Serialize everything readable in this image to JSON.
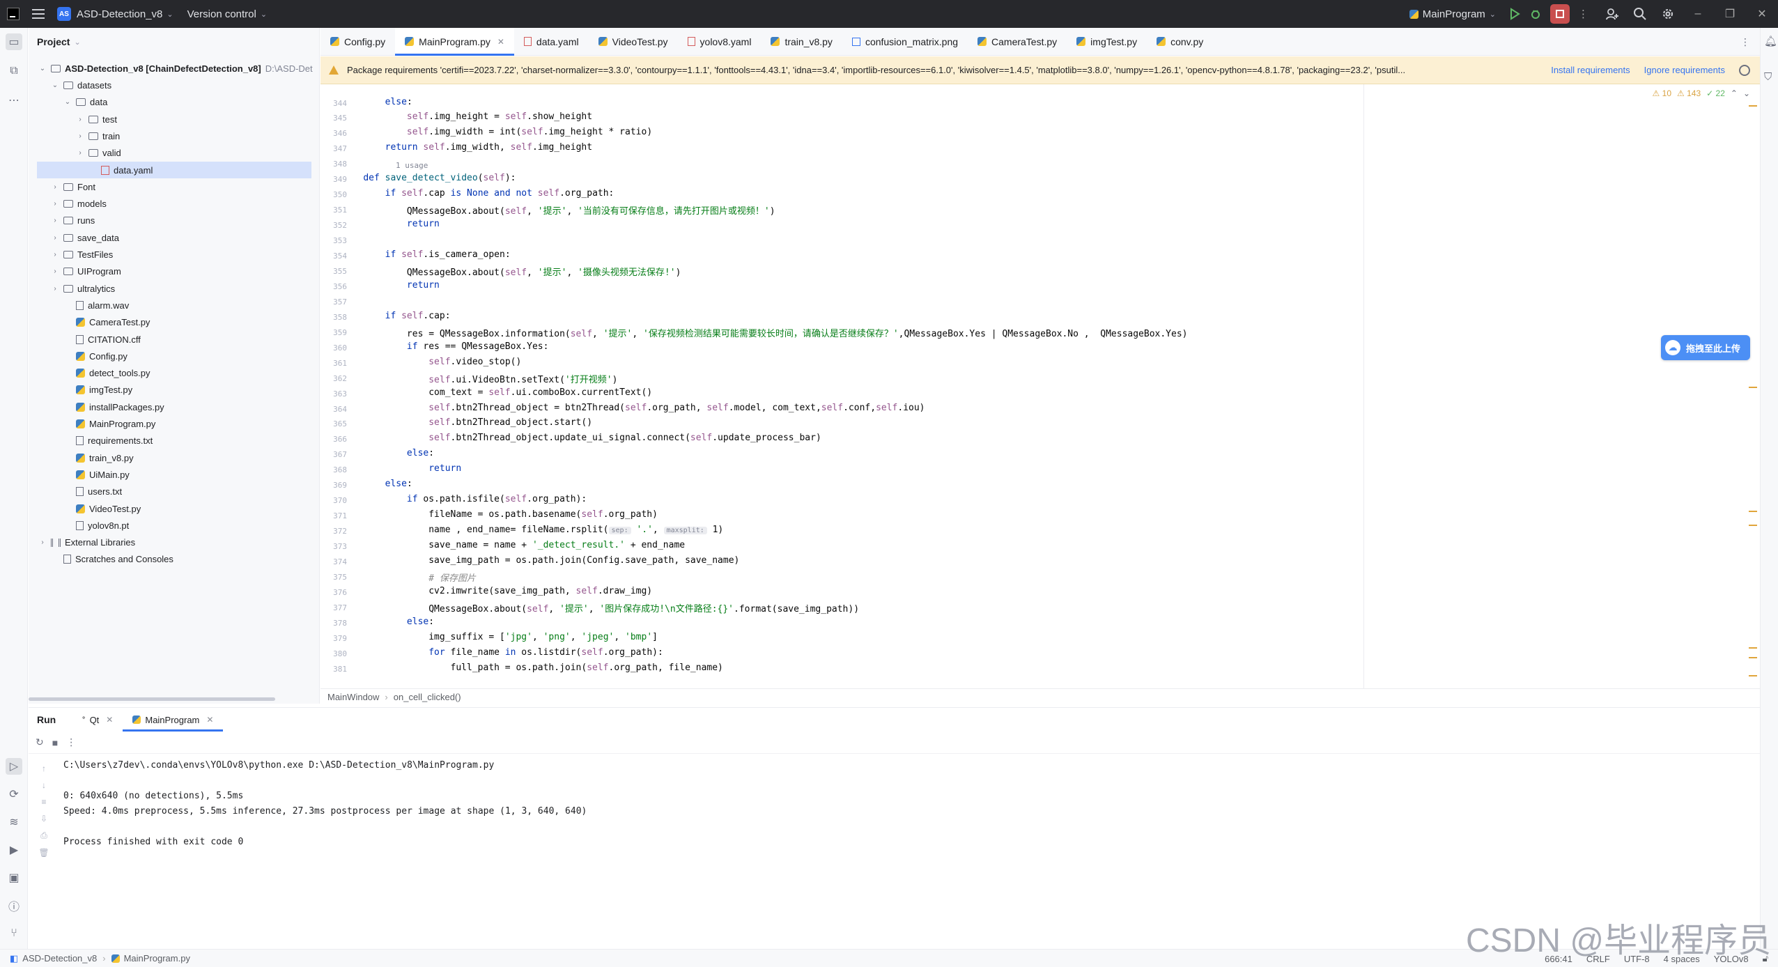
{
  "titlebar": {
    "project_name": "ASD-Detection_v8",
    "project_badge": "AS",
    "vcs": "Version control",
    "run_config": "MainProgram"
  },
  "project_panel": {
    "title": "Project",
    "root": {
      "label": "ASD-Detection_v8 [ChainDefectDetection_v8]",
      "path": "D:\\ASD-Det"
    },
    "items": [
      {
        "label": "datasets",
        "type": "folder",
        "indent": 1,
        "open": true
      },
      {
        "label": "data",
        "type": "folder",
        "indent": 2,
        "open": true
      },
      {
        "label": "test",
        "type": "folder",
        "indent": 3,
        "open": false
      },
      {
        "label": "train",
        "type": "folder",
        "indent": 3,
        "open": false
      },
      {
        "label": "valid",
        "type": "folder",
        "indent": 3,
        "open": false
      },
      {
        "label": "data.yaml",
        "type": "yaml",
        "indent": 4,
        "selected": true
      },
      {
        "label": "Font",
        "type": "folder",
        "indent": 1,
        "open": false
      },
      {
        "label": "models",
        "type": "folder",
        "indent": 1,
        "open": false
      },
      {
        "label": "runs",
        "type": "folder",
        "indent": 1,
        "open": false
      },
      {
        "label": "save_data",
        "type": "folder",
        "indent": 1,
        "open": false
      },
      {
        "label": "TestFiles",
        "type": "folder",
        "indent": 1,
        "open": false
      },
      {
        "label": "UIProgram",
        "type": "folder",
        "indent": 1,
        "open": false
      },
      {
        "label": "ultralytics",
        "type": "folder",
        "indent": 1,
        "open": false
      },
      {
        "label": "alarm.wav",
        "type": "file",
        "indent": 2
      },
      {
        "label": "CameraTest.py",
        "type": "py",
        "indent": 2
      },
      {
        "label": "CITATION.cff",
        "type": "file",
        "indent": 2
      },
      {
        "label": "Config.py",
        "type": "py",
        "indent": 2
      },
      {
        "label": "detect_tools.py",
        "type": "py",
        "indent": 2
      },
      {
        "label": "imgTest.py",
        "type": "py",
        "indent": 2
      },
      {
        "label": "installPackages.py",
        "type": "py",
        "indent": 2
      },
      {
        "label": "MainProgram.py",
        "type": "py",
        "indent": 2
      },
      {
        "label": "requirements.txt",
        "type": "file",
        "indent": 2
      },
      {
        "label": "train_v8.py",
        "type": "py",
        "indent": 2
      },
      {
        "label": "UiMain.py",
        "type": "py",
        "indent": 2
      },
      {
        "label": "users.txt",
        "type": "file",
        "indent": 2
      },
      {
        "label": "VideoTest.py",
        "type": "py",
        "indent": 2
      },
      {
        "label": "yolov8n.pt",
        "type": "file",
        "indent": 2
      },
      {
        "label": "External Libraries",
        "type": "lib",
        "indent": 0,
        "open": false
      },
      {
        "label": "Scratches and Consoles",
        "type": "scratch",
        "indent": 1
      }
    ]
  },
  "tabs": [
    {
      "label": "Config.py",
      "icon": "py"
    },
    {
      "label": "MainProgram.py",
      "icon": "py",
      "active": true
    },
    {
      "label": "data.yaml",
      "icon": "yaml"
    },
    {
      "label": "VideoTest.py",
      "icon": "py"
    },
    {
      "label": "yolov8.yaml",
      "icon": "yaml"
    },
    {
      "label": "train_v8.py",
      "icon": "py"
    },
    {
      "label": "confusion_matrix.png",
      "icon": "png"
    },
    {
      "label": "CameraTest.py",
      "icon": "py"
    },
    {
      "label": "imgTest.py",
      "icon": "py"
    },
    {
      "label": "conv.py",
      "icon": "py"
    }
  ],
  "banner": {
    "text": "Package requirements 'certifi==2023.7.22', 'charset-normalizer==3.3.0', 'contourpy==1.1.1', 'fonttools==4.43.1', 'idna==3.4', 'importlib-resources==6.1.0', 'kiwisolver==1.4.5', 'matplotlib==3.8.0', 'numpy==1.26.1', 'opencv-python==4.8.1.78', 'packaging==23.2', 'psutil...",
    "install": "Install requirements",
    "ignore": "Ignore requirements"
  },
  "inspections": {
    "warn1": "10",
    "warn2": "143",
    "ok": "22"
  },
  "code": {
    "usage_hint": "1 usage",
    "lines": [
      {
        "n": "344",
        "html": "        <span class='kw'>else</span>:"
      },
      {
        "n": "345",
        "html": "            <span class='slf'>self</span>.img_height = <span class='slf'>self</span>.show_height"
      },
      {
        "n": "346",
        "html": "            <span class='slf'>self</span>.img_width = int(<span class='slf'>self</span>.img_height * ratio)"
      },
      {
        "n": "347",
        "html": "        <span class='kw'>return</span> <span class='slf'>self</span>.img_width, <span class='slf'>self</span>.img_height"
      },
      {
        "n": "348",
        "html": ""
      },
      {
        "n": "349",
        "html": "    <span class='kw'>def</span> <span class='fn'>save_detect_video</span>(<span class='slf'>self</span>):"
      },
      {
        "n": "350",
        "html": "        <span class='kw'>if</span> <span class='slf'>self</span>.cap <span class='kw'>is None and not</span> <span class='slf'>self</span>.org_path:"
      },
      {
        "n": "351",
        "html": "            QMessageBox.about(<span class='slf'>self</span>, <span class='str'>'提示'</span>, <span class='str'>'当前没有可保存信息，请先打开图片或视频！'</span>)"
      },
      {
        "n": "352",
        "html": "            <span class='kw'>return</span>"
      },
      {
        "n": "353",
        "html": ""
      },
      {
        "n": "354",
        "html": "        <span class='kw'>if</span> <span class='slf'>self</span>.is_camera_open:"
      },
      {
        "n": "355",
        "html": "            QMessageBox.about(<span class='slf'>self</span>, <span class='str'>'提示'</span>, <span class='str'>'摄像头视频无法保存!'</span>)"
      },
      {
        "n": "356",
        "html": "            <span class='kw'>return</span>"
      },
      {
        "n": "357",
        "html": ""
      },
      {
        "n": "358",
        "html": "        <span class='kw'>if</span> <span class='slf'>self</span>.cap:"
      },
      {
        "n": "359",
        "html": "            res = QMessageBox.information(<span class='slf'>self</span>, <span class='str'>'提示'</span>, <span class='str'>'保存视频检测结果可能需要较长时间，请确认是否继续保存？'</span>,QMessageBox.Yes | QMessageBox.No ,  QMessageBox.Yes)"
      },
      {
        "n": "360",
        "html": "            <span class='kw'>if</span> res == QMessageBox.Yes:"
      },
      {
        "n": "361",
        "html": "                <span class='slf'>self</span>.video_stop()"
      },
      {
        "n": "362",
        "html": "                <span class='slf'>self</span>.ui.VideoBtn.setText(<span class='str'>'打开视频'</span>)"
      },
      {
        "n": "363",
        "html": "                com_text = <span class='slf'>self</span>.ui.comboBox.currentText()"
      },
      {
        "n": "364",
        "html": "                <span class='slf'>self</span>.btn2Thread_object = btn2Thread(<span class='slf'>self</span>.org_path, <span class='slf'>self</span>.model, com_text,<span class='slf'>self</span>.conf,<span class='slf'>self</span>.iou)"
      },
      {
        "n": "365",
        "html": "                <span class='slf'>self</span>.btn2Thread_object.start()"
      },
      {
        "n": "366",
        "html": "                <span class='slf'>self</span>.btn2Thread_object.update_ui_signal.connect(<span class='slf'>self</span>.update_process_bar)"
      },
      {
        "n": "367",
        "html": "            <span class='kw'>else</span>:"
      },
      {
        "n": "368",
        "html": "                <span class='kw'>return</span>"
      },
      {
        "n": "369",
        "html": "        <span class='kw'>else</span>:"
      },
      {
        "n": "370",
        "html": "            <span class='kw'>if</span> os.path.isfile(<span class='slf'>self</span>.org_path):"
      },
      {
        "n": "371",
        "html": "                fileName = os.path.basename(<span class='slf'>self</span>.org_path)"
      },
      {
        "n": "372",
        "html": "                name , end_name= fileName.rsplit(<span class='hint'>sep:</span> <span class='str'>'.'</span>, <span class='hint'>maxsplit:</span> 1)"
      },
      {
        "n": "373",
        "html": "                save_name = name + <span class='str'>'_detect_result.'</span> + end_name"
      },
      {
        "n": "374",
        "html": "                save_img_path = os.path.join(Config.save_path, save_name)"
      },
      {
        "n": "375",
        "html": "                <span class='cmt'># 保存图片</span>"
      },
      {
        "n": "376",
        "html": "                cv2.imwrite(save_img_path, <span class='slf'>self</span>.draw_img)"
      },
      {
        "n": "377",
        "html": "                QMessageBox.about(<span class='slf'>self</span>, <span class='str'>'提示'</span>, <span class='str'>'图片保存成功!\\n文件路径:{}'</span>.format(save_img_path))"
      },
      {
        "n": "378",
        "html": "            <span class='kw'>else</span>:"
      },
      {
        "n": "379",
        "html": "                img_suffix = [<span class='str'>'jpg'</span>, <span class='str'>'png'</span>, <span class='str'>'jpeg'</span>, <span class='str'>'bmp'</span>]"
      },
      {
        "n": "380",
        "html": "                <span class='kw'>for</span> file_name <span class='kw'>in</span> os.listdir(<span class='slf'>self</span>.org_path):"
      },
      {
        "n": "381",
        "html": "                    full_path = os.path.join(<span class='slf'>self</span>.org_path, file_name)"
      }
    ]
  },
  "breadcrumb": {
    "class_name": "MainWindow",
    "method": "on_cell_clicked()"
  },
  "upload_badge": "拖拽至此上传",
  "run_panel": {
    "title": "Run",
    "tabs": [
      {
        "label": "Qt"
      },
      {
        "label": "MainProgram",
        "active": true
      }
    ],
    "console": [
      "C:\\Users\\z7dev\\.conda\\envs\\YOLOv8\\python.exe D:\\ASD-Detection_v8\\MainProgram.py",
      "",
      "0: 640x640 (no detections), 5.5ms",
      "Speed: 4.0ms preprocess, 5.5ms inference, 27.3ms postprocess per image at shape (1, 3, 640, 640)",
      "",
      "Process finished with exit code 0"
    ]
  },
  "statusbar": {
    "project": "ASD-Detection_v8",
    "file": "MainProgram.py",
    "position": "666:41",
    "line_sep": "CRLF",
    "encoding": "UTF-8",
    "indent": "4 spaces",
    "interpreter": "YOLOv8"
  },
  "watermark": "CSDN @毕业程序员"
}
